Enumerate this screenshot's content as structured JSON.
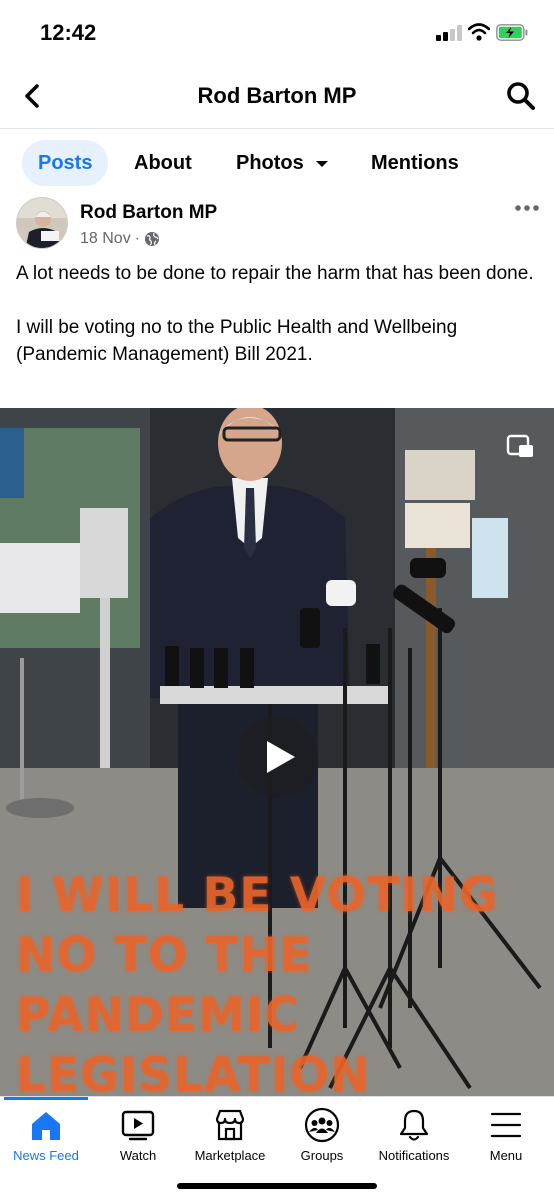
{
  "status_bar": {
    "time": "12:42",
    "signal_icon": "cellular-signal-icon",
    "wifi_icon": "wifi-icon",
    "battery_icon": "battery-charging-icon",
    "battery_color": "#30d158"
  },
  "header": {
    "title": "Rod Barton MP",
    "back_icon": "chevron-left-icon",
    "search_icon": "search-icon"
  },
  "tabs": [
    {
      "label": "Posts",
      "active": true
    },
    {
      "label": "About"
    },
    {
      "label": "Photos",
      "has_dropdown": true
    },
    {
      "label": "Mentions"
    }
  ],
  "post": {
    "author": "Rod Barton MP",
    "date": "18 Nov",
    "separator": "·",
    "privacy_icon": "globe-icon",
    "more_icon": "more-horizontal-icon",
    "paragraphs": [
      "A lot needs to be done to repair the harm that has been done.",
      "I will be voting no to the Public Health and Wellbeing (Pandemic Management) Bill 2021."
    ],
    "video": {
      "overlay_lines": [
        "I WILL BE VOTING",
        "NO TO THE",
        "PANDEMIC",
        "LEGISLATION"
      ],
      "play_icon": "play-icon",
      "pip_icon": "picture-in-picture-icon"
    }
  },
  "bottom_nav": [
    {
      "label": "News Feed",
      "icon": "home-icon",
      "active": true
    },
    {
      "label": "Watch",
      "icon": "watch-video-icon"
    },
    {
      "label": "Marketplace",
      "icon": "marketplace-store-icon"
    },
    {
      "label": "Groups",
      "icon": "groups-icon"
    },
    {
      "label": "Notifications",
      "icon": "bell-icon"
    },
    {
      "label": "Menu",
      "icon": "menu-hamburger-icon"
    }
  ],
  "colors": {
    "accent": "#1877f2",
    "tab_active_bg": "#e7f0fd",
    "overlay_text": "#e8642a",
    "secondary_text": "#65676b"
  }
}
